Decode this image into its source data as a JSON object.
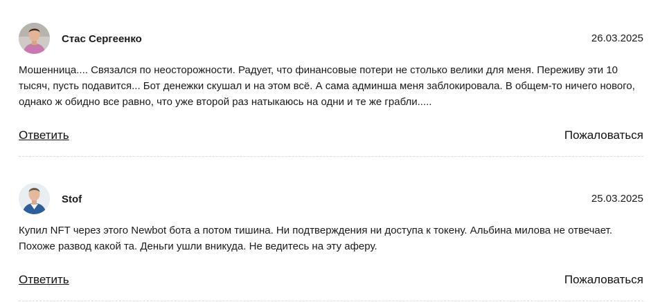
{
  "comments": [
    {
      "author": "Стас Сергеенко",
      "date": "26.03.2025",
      "text": "Мошенница.... Связался по неосторожности. Радует, что финансовые потери не столько велики для меня. Переживу эти 10 тысяч, пусть подавится... Бот денежки скушал и на этом всё. А сама админша меня заблокировала. В общем-то ничего нового, однако ж обидно все равно, что уже второй раз натыкаюсь на одни и те же грабли.....",
      "reply_label": "Ответить",
      "report_label": "Пожаловаться"
    },
    {
      "author": "Stof",
      "date": "25.03.2025",
      "text": "Купил NFT через этого Newbot бота а потом тишина. Ни подтверждения ни доступа к токену. Альбина милова не отвечает. Похоже развод какой та. Деньги ушли вникуда. Не ведитесь на эту аферу.",
      "reply_label": "Ответить",
      "report_label": "Пожаловаться"
    }
  ]
}
